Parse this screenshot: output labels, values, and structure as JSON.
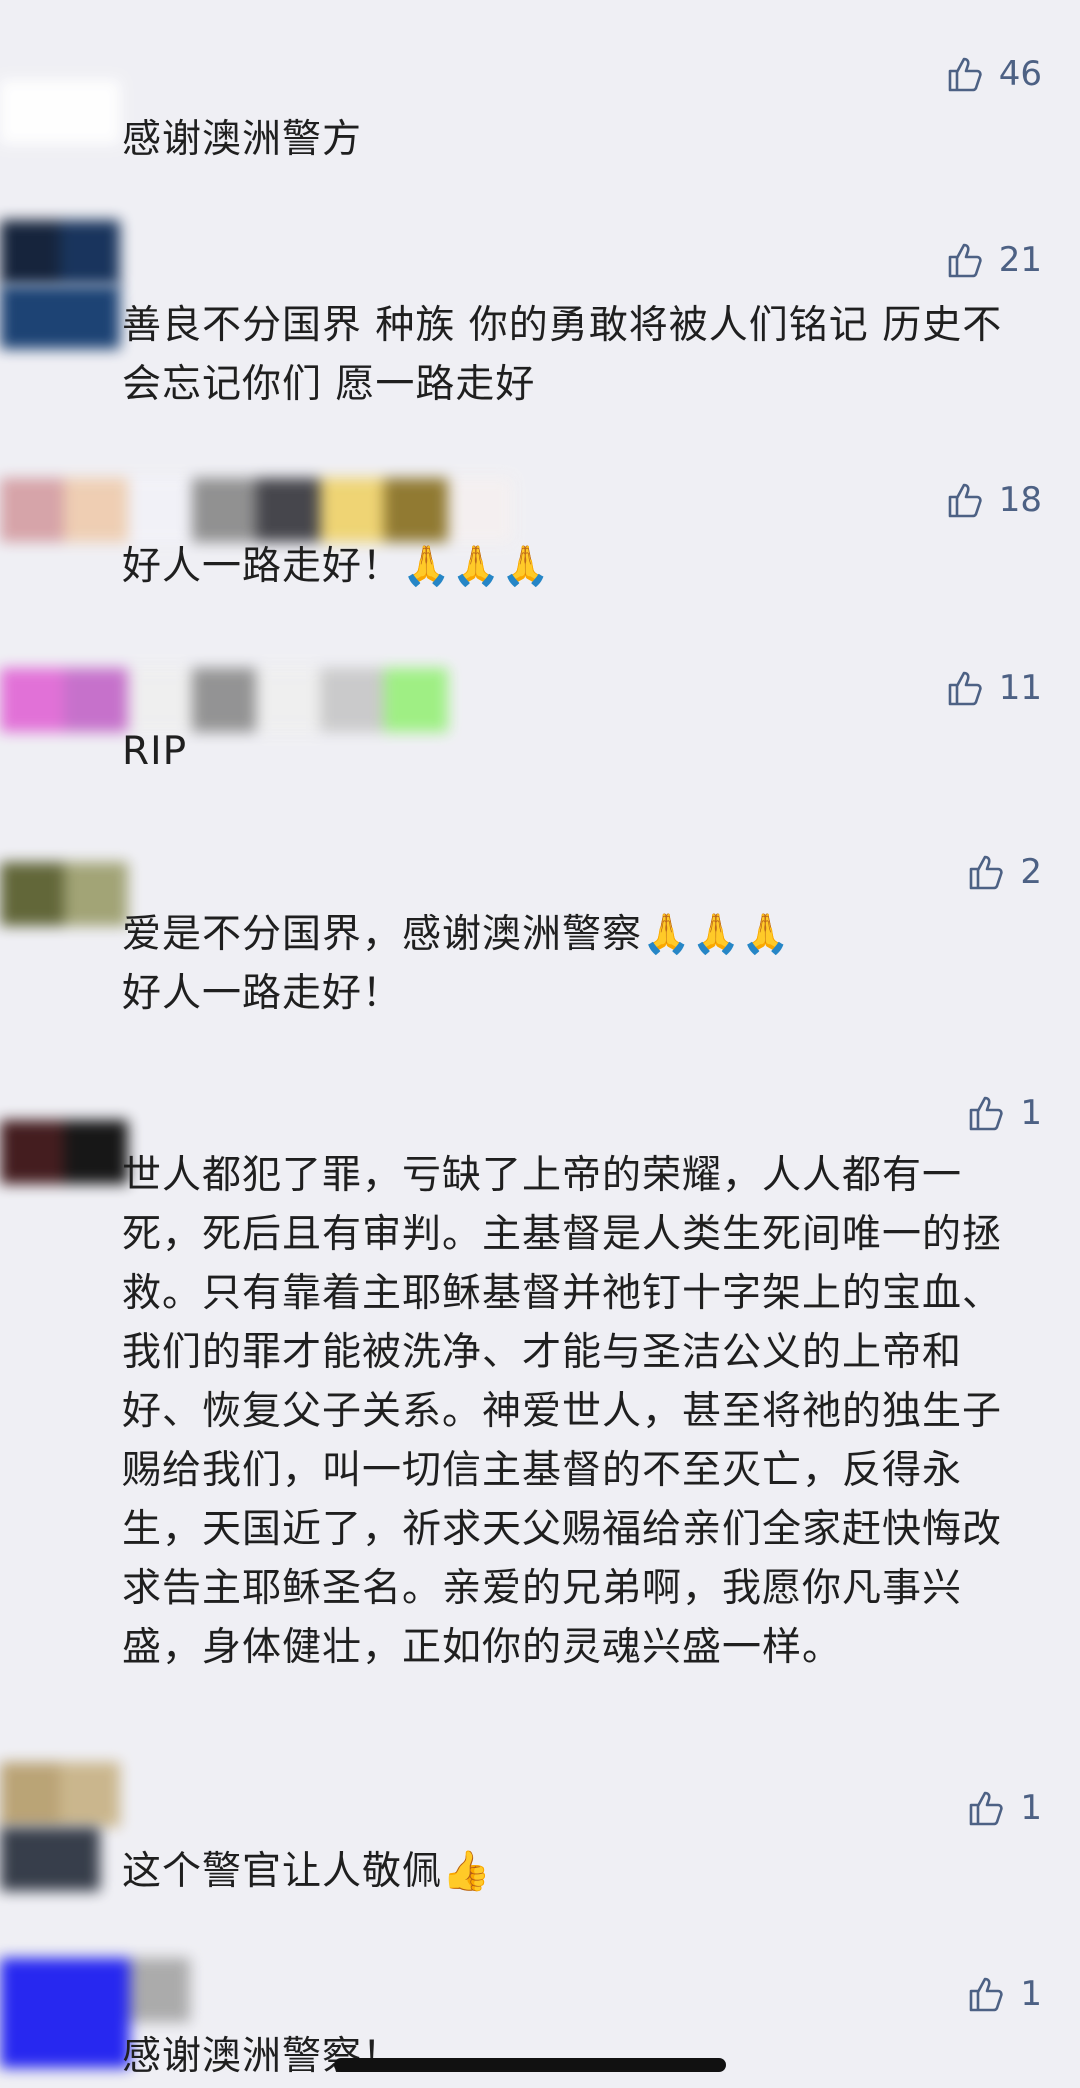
{
  "comments": [
    {
      "text": "感谢澳洲警方",
      "likes": "46",
      "avatar_colors": [
        "#ffffff",
        "#f6f6f6"
      ]
    },
    {
      "text": "善良不分国界 种族 你的勇敢将被人们铭记 历史不会忘记你们 愿一路走好",
      "likes": "21",
      "avatar_colors": [
        "#0b1a33",
        "#0e2b55"
      ]
    },
    {
      "text": "好人一路走好！🙏🙏🙏",
      "likes": "18",
      "avatar_colors": [
        "#d5a0a5",
        "#efcdb0",
        "#f2f2f8",
        "#8c8c8c",
        "#3e3e44",
        "#efd36e",
        "#8c7428",
        "#f5f0f0"
      ]
    },
    {
      "text": "RIP",
      "likes": "11",
      "avatar_colors": [
        "#e16bd6",
        "#c46bc9",
        "#efefef",
        "#8f8f8f",
        "#efefef",
        "#c9c9c9",
        "#9bf07f"
      ]
    },
    {
      "text": "爱是不分国界，感谢澳洲警察🙏🙏🙏\n好人一路走好！",
      "likes": "2",
      "avatar_colors": [
        "#5b6030",
        "#9ea070"
      ]
    },
    {
      "text": "世人都犯了罪，亏缺了上帝的荣耀，人人都有一死，死后且有审判。主基督是人类生死间唯一的拯救。只有靠着主耶稣基督并祂钉十字架上的宝血、我们的罪才能被洗净、才能与圣洁公义的上帝和好、恢复父子关系。神爱世人，甚至将祂的独生子赐给我们，叫一切信主基督的不至灭亡，反得永生，天国近了，祈求天父赐福给亲们全家赶快悔改求告主耶稣圣名。亲爱的兄弟啊，我愿你凡事兴盛，身体健壮，正如你的灵魂兴盛一样。",
      "likes": "1",
      "avatar_colors": [
        "#3b1214",
        "#0c0c0c"
      ]
    },
    {
      "text": "这个警官让人敬佩👍",
      "likes": "1",
      "avatar_colors": [
        "#b8a070",
        "#2e3542"
      ]
    },
    {
      "text": "感谢澳洲警察！",
      "likes": "1",
      "avatar_colors": [
        "#1d1ef0",
        "#a8a8a8"
      ]
    }
  ]
}
